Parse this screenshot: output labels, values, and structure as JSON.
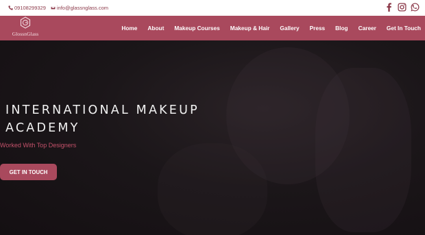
{
  "topbar": {
    "phone": "09108299329",
    "email": "info@glassnglass.com",
    "socials": [
      "facebook-icon",
      "instagram-icon",
      "whatsapp-icon"
    ]
  },
  "brand": {
    "logo_text": "GlossnGlass"
  },
  "nav": {
    "items": [
      "Home",
      "About",
      "Makeup Courses",
      "Makeup & Hair",
      "Gallery",
      "Press",
      "Blog",
      "Career",
      "Get In Touch"
    ]
  },
  "hero": {
    "title": "INTERNATIONAL MAKEUP ACADEMY",
    "subtitle": "Worked With Top Designers",
    "cta_label": "GET IN TOUCH"
  },
  "colors": {
    "accent": "#a9495d",
    "topbar_text": "#8c3a4a",
    "hero_bg": "#1b1619"
  }
}
